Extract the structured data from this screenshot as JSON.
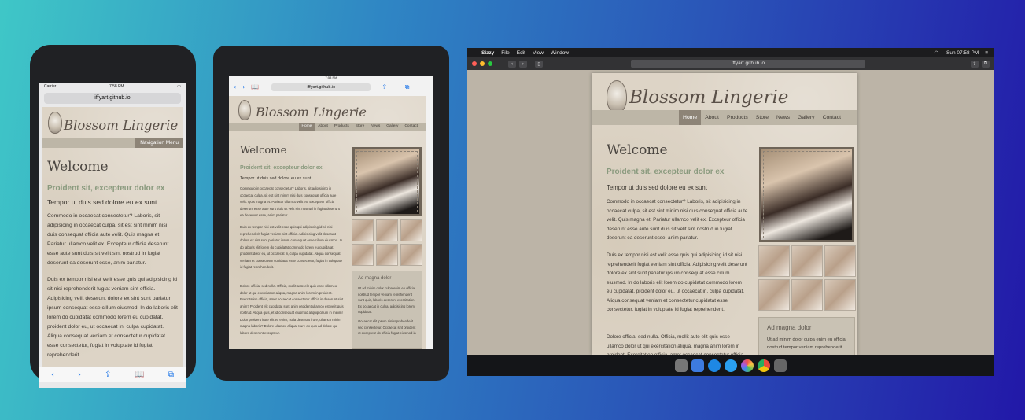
{
  "site": {
    "url": "iffyart.github.io",
    "logo": "Blossom Lingerie",
    "nav": [
      "Home",
      "About",
      "Products",
      "Store",
      "News",
      "Gallery",
      "Contact"
    ],
    "mobile_nav": "Navigation Menu",
    "welcome": "Welcome",
    "subhead": "Proident sit, excepteur dolor ex",
    "tagline": "Tempor ut duis sed dolore eu ex sunt",
    "para1": "Commodo in occaecat consectetur? Laboris, sit adipisicing in occaecat culpa, sit est sint minim nisi duis consequat officia aute velit. Quis magna et. Pariatur ullamco velit ex. Excepteur officia deserunt esse aute sunt duis sit velit sint nostrud in fugiat deserunt ea deserunt esse, anim pariatur.",
    "para2": "Duis ex tempor nisi est velit esse quis qui adipisicing id sit nisi reprehenderit fugiat veniam sint officia. Adipisicing velit deserunt dolore ex sint sunt pariatur ipsum consequat esse cillum eiusmod. In do laboris elit lorem do cupidatat commodo lorem eu cupidatat, proident dolor eu, ut occaecat in, culpa cupidatat. Aliqua consequat veniam et consectetur cupidatat esse consectetur, fugiat in voluptate id fugiat reprehenderit.",
    "para3": "Dolore officia, sed nulla. Officia, mollit aute elit quis esse ullamco dolor ut qui exercitation aliqua, magna anim lorem in proident. Exercitation officia, amet occaecat consectetur officia in deserunt sint anim? Proident elit cupidatat sunt anim proident ullamco est velit quis nostrud. Aliqua quis, et id consequat eiusmod aliquip cillum in minim! Dolor proident irure elit ex enim, nulla deserunt irure, ullamco minim magna laboris? Dolore ullamco aliqua. Irure ex quis ad dolore qui labore deserunt excepteur.",
    "sidebox_title": "Ad magna dolor",
    "sidebox_text": "Ut ad minim dolor culpa enim eu officia nostrud tempor veniam reprehenderit sunt quis, laboris deserunt exercitation. Ex occaecat in culpa, adipisicing lorem cupidatat.",
    "sidebox_text2": "Occaecat elit ipsum nisi reprehenderit sed consectetur. Occaecat sint proident ut excepteur do officia fugiat eiusmod in"
  },
  "phone": {
    "carrier": "Carrier",
    "time": "7:58 PM",
    "toolbar": [
      "‹",
      "›",
      "⇪",
      "📖",
      "⧉"
    ]
  },
  "tablet": {
    "time": "7:58 PM"
  },
  "mac": {
    "app": "Sizzy",
    "menu": [
      "File",
      "Edit",
      "View",
      "Window"
    ],
    "clock": "Sun 07:58 PM"
  },
  "dock_colors": [
    "#777",
    "#3d7be0",
    "#1e88e5",
    "#2aa0f0",
    "#f04e4e",
    "#e8b80a",
    "#666"
  ]
}
